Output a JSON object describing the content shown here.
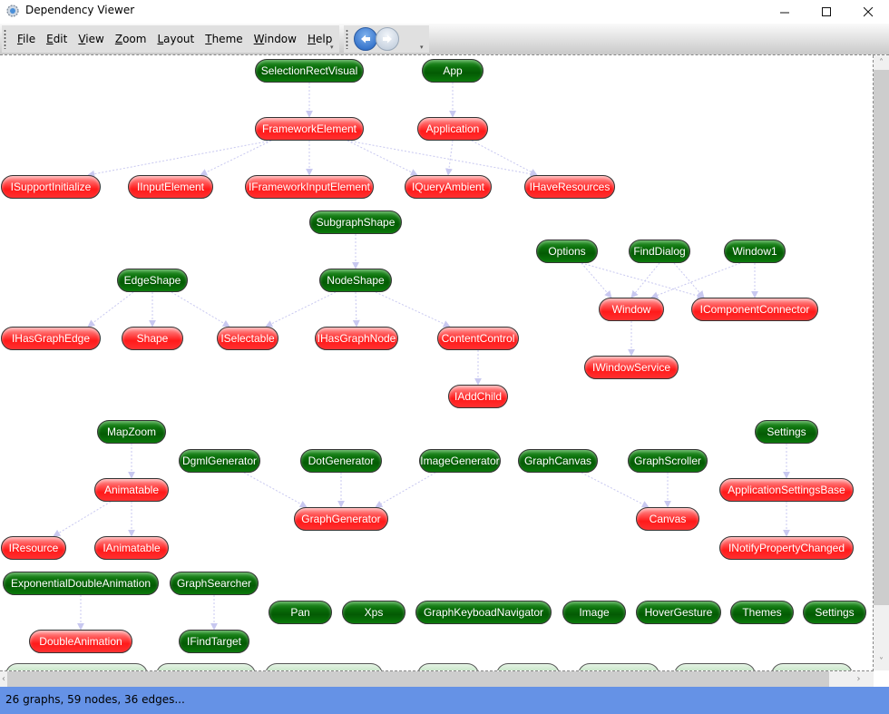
{
  "window": {
    "title": "Dependency Viewer",
    "icon": "gear-app-icon",
    "controls": [
      "minimize",
      "maximize",
      "close"
    ]
  },
  "menu": {
    "items": [
      {
        "label": "File",
        "access_key": "F"
      },
      {
        "label": "Edit",
        "access_key": "E"
      },
      {
        "label": "View",
        "access_key": "V"
      },
      {
        "label": "Zoom",
        "access_key": "Z"
      },
      {
        "label": "Layout",
        "access_key": "L"
      },
      {
        "label": "Theme",
        "access_key": "T"
      },
      {
        "label": "Window",
        "access_key": "W"
      },
      {
        "label": "Help",
        "access_key": "H"
      }
    ]
  },
  "navigation": {
    "back": {
      "icon": "arrow-left-icon",
      "enabled": true
    },
    "forward": {
      "icon": "arrow-right-icon",
      "enabled": false
    }
  },
  "colors": {
    "class_node": "#0a6e0a",
    "dependency_node": "#ff2020",
    "edge": "#c8c8f0",
    "status_bar": "#6592e6"
  },
  "graph": {
    "nodes": [
      {
        "id": "SelectionRectVisual",
        "label": "SelectionRectVisual",
        "kind": "green"
      },
      {
        "id": "App",
        "label": "App",
        "kind": "green"
      },
      {
        "id": "FrameworkElement",
        "label": "FrameworkElement",
        "kind": "red"
      },
      {
        "id": "Application",
        "label": "Application",
        "kind": "red"
      },
      {
        "id": "ISupportInitialize",
        "label": "ISupportInitialize",
        "kind": "red"
      },
      {
        "id": "IInputElement",
        "label": "IInputElement",
        "kind": "red"
      },
      {
        "id": "IFrameworkInputElement",
        "label": "IFrameworkInputElement",
        "kind": "red"
      },
      {
        "id": "IQueryAmbient",
        "label": "IQueryAmbient",
        "kind": "red"
      },
      {
        "id": "IHaveResources",
        "label": "IHaveResources",
        "kind": "red"
      },
      {
        "id": "SubgraphShape",
        "label": "SubgraphShape",
        "kind": "green"
      },
      {
        "id": "EdgeShape",
        "label": "EdgeShape",
        "kind": "green"
      },
      {
        "id": "NodeShape",
        "label": "NodeShape",
        "kind": "green"
      },
      {
        "id": "IHasGraphEdge",
        "label": "IHasGraphEdge",
        "kind": "red"
      },
      {
        "id": "Shape",
        "label": "Shape",
        "kind": "red"
      },
      {
        "id": "ISelectable",
        "label": "ISelectable",
        "kind": "red"
      },
      {
        "id": "IHasGraphNode",
        "label": "IHasGraphNode",
        "kind": "red"
      },
      {
        "id": "ContentControl",
        "label": "ContentControl",
        "kind": "red"
      },
      {
        "id": "IAddChild",
        "label": "IAddChild",
        "kind": "red"
      },
      {
        "id": "Options",
        "label": "Options",
        "kind": "green"
      },
      {
        "id": "FindDialog",
        "label": "FindDialog",
        "kind": "green"
      },
      {
        "id": "Window1",
        "label": "Window1",
        "kind": "green"
      },
      {
        "id": "Window",
        "label": "Window",
        "kind": "red"
      },
      {
        "id": "IComponentConnector",
        "label": "IComponentConnector",
        "kind": "red"
      },
      {
        "id": "IWindowService",
        "label": "IWindowService",
        "kind": "red"
      },
      {
        "id": "MapZoom",
        "label": "MapZoom",
        "kind": "green"
      },
      {
        "id": "Animatable",
        "label": "Animatable",
        "kind": "red"
      },
      {
        "id": "IResource",
        "label": "IResource",
        "kind": "red"
      },
      {
        "id": "IAnimatable",
        "label": "IAnimatable",
        "kind": "red"
      },
      {
        "id": "DgmlGenerator",
        "label": "DgmlGenerator",
        "kind": "green"
      },
      {
        "id": "DotGenerator",
        "label": "DotGenerator",
        "kind": "green"
      },
      {
        "id": "ImageGenerator",
        "label": "ImageGenerator",
        "kind": "green"
      },
      {
        "id": "GraphGenerator",
        "label": "GraphGenerator",
        "kind": "red"
      },
      {
        "id": "GraphCanvas",
        "label": "GraphCanvas",
        "kind": "green"
      },
      {
        "id": "GraphScroller",
        "label": "GraphScroller",
        "kind": "green"
      },
      {
        "id": "Canvas",
        "label": "Canvas",
        "kind": "red"
      },
      {
        "id": "Settings",
        "label": "Settings",
        "kind": "green"
      },
      {
        "id": "ApplicationSettingsBase",
        "label": "ApplicationSettingsBase",
        "kind": "red"
      },
      {
        "id": "INotifyPropertyChanged",
        "label": "INotifyPropertyChanged",
        "kind": "red"
      },
      {
        "id": "ExponentialDoubleAnimation",
        "label": "ExponentialDoubleAnimation",
        "kind": "green"
      },
      {
        "id": "DoubleAnimation",
        "label": "DoubleAnimation",
        "kind": "red"
      },
      {
        "id": "GraphSearcher",
        "label": "GraphSearcher",
        "kind": "green"
      },
      {
        "id": "IFindTarget",
        "label": "IFindTarget",
        "kind": "green"
      },
      {
        "id": "Pan",
        "label": "Pan",
        "kind": "green"
      },
      {
        "id": "Xps",
        "label": "Xps",
        "kind": "green"
      },
      {
        "id": "GraphKeyboadNavigator",
        "label": "GraphKeyboadNavigator",
        "kind": "green"
      },
      {
        "id": "Image",
        "label": "Image",
        "kind": "green"
      },
      {
        "id": "HoverGesture",
        "label": "HoverGesture",
        "kind": "green"
      },
      {
        "id": "Themes",
        "label": "Themes",
        "kind": "green"
      },
      {
        "id": "Settings2",
        "label": "Settings",
        "kind": "green"
      }
    ],
    "edges": [
      [
        "SelectionRectVisual",
        "FrameworkElement"
      ],
      [
        "App",
        "Application"
      ],
      [
        "FrameworkElement",
        "ISupportInitialize"
      ],
      [
        "FrameworkElement",
        "IInputElement"
      ],
      [
        "FrameworkElement",
        "IFrameworkInputElement"
      ],
      [
        "FrameworkElement",
        "IQueryAmbient"
      ],
      [
        "FrameworkElement",
        "IHaveResources"
      ],
      [
        "Application",
        "IQueryAmbient"
      ],
      [
        "Application",
        "IHaveResources"
      ],
      [
        "SubgraphShape",
        "NodeShape"
      ],
      [
        "EdgeShape",
        "IHasGraphEdge"
      ],
      [
        "EdgeShape",
        "Shape"
      ],
      [
        "EdgeShape",
        "ISelectable"
      ],
      [
        "NodeShape",
        "ISelectable"
      ],
      [
        "NodeShape",
        "IHasGraphNode"
      ],
      [
        "NodeShape",
        "ContentControl"
      ],
      [
        "ContentControl",
        "IAddChild"
      ],
      [
        "Options",
        "Window"
      ],
      [
        "Options",
        "IComponentConnector"
      ],
      [
        "FindDialog",
        "Window"
      ],
      [
        "FindDialog",
        "IComponentConnector"
      ],
      [
        "Window1",
        "Window"
      ],
      [
        "Window1",
        "IComponentConnector"
      ],
      [
        "Window",
        "IWindowService"
      ],
      [
        "MapZoom",
        "Animatable"
      ],
      [
        "Animatable",
        "IResource"
      ],
      [
        "Animatable",
        "IAnimatable"
      ],
      [
        "DgmlGenerator",
        "GraphGenerator"
      ],
      [
        "DotGenerator",
        "GraphGenerator"
      ],
      [
        "ImageGenerator",
        "GraphGenerator"
      ],
      [
        "GraphCanvas",
        "Canvas"
      ],
      [
        "GraphScroller",
        "Canvas"
      ],
      [
        "Settings",
        "ApplicationSettingsBase"
      ],
      [
        "ApplicationSettingsBase",
        "INotifyPropertyChanged"
      ],
      [
        "ExponentialDoubleAnimation",
        "DoubleAnimation"
      ],
      [
        "GraphSearcher",
        "IFindTarget"
      ]
    ],
    "partially_visible_nodes_count": 8
  },
  "scroll": {
    "vertical_fraction_visible": 0.9,
    "vertical_position": 0,
    "horizontal_fraction_visible": 0.96,
    "horizontal_position": 0
  },
  "status": {
    "text": "26 graphs, 59 nodes, 36 edges..."
  }
}
